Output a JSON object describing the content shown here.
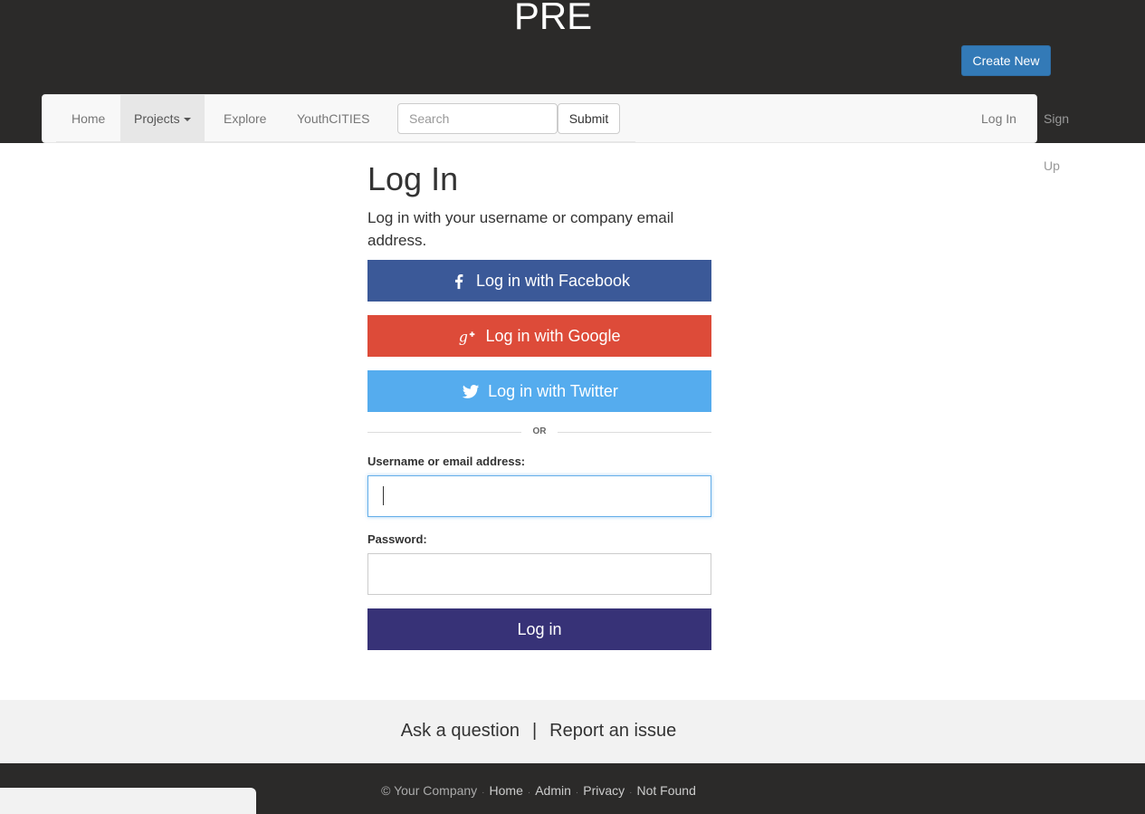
{
  "header": {
    "site_title": "PRE",
    "create_button": "Create New"
  },
  "nav": {
    "items": [
      {
        "label": "Home"
      },
      {
        "label": "Projects"
      },
      {
        "label": "Explore"
      },
      {
        "label": "YouthCITIES"
      }
    ],
    "search_placeholder": "Search",
    "submit_label": "Submit",
    "login_label": "Log In",
    "signup_label": "Sign Up"
  },
  "login": {
    "title": "Log In",
    "intro": "Log in with your username or company email address.",
    "facebook_label": "Log in with Facebook",
    "google_label": "Log in with Google",
    "twitter_label": "Log in with Twitter",
    "or_text": "OR",
    "username_label": "Username or email address:",
    "username_value": "",
    "password_label": "Password:",
    "password_value": "",
    "submit_label": "Log in",
    "colors": {
      "facebook": "#3b5998",
      "google": "#dd4b39",
      "twitter": "#55acee",
      "login": "#373277"
    }
  },
  "help": {
    "ask": "Ask a question",
    "separator": "|",
    "report": "Report an issue"
  },
  "footer": {
    "copyright": "© Your Company",
    "links": [
      "Home",
      "Admin",
      "Privacy",
      "Not Found"
    ]
  }
}
